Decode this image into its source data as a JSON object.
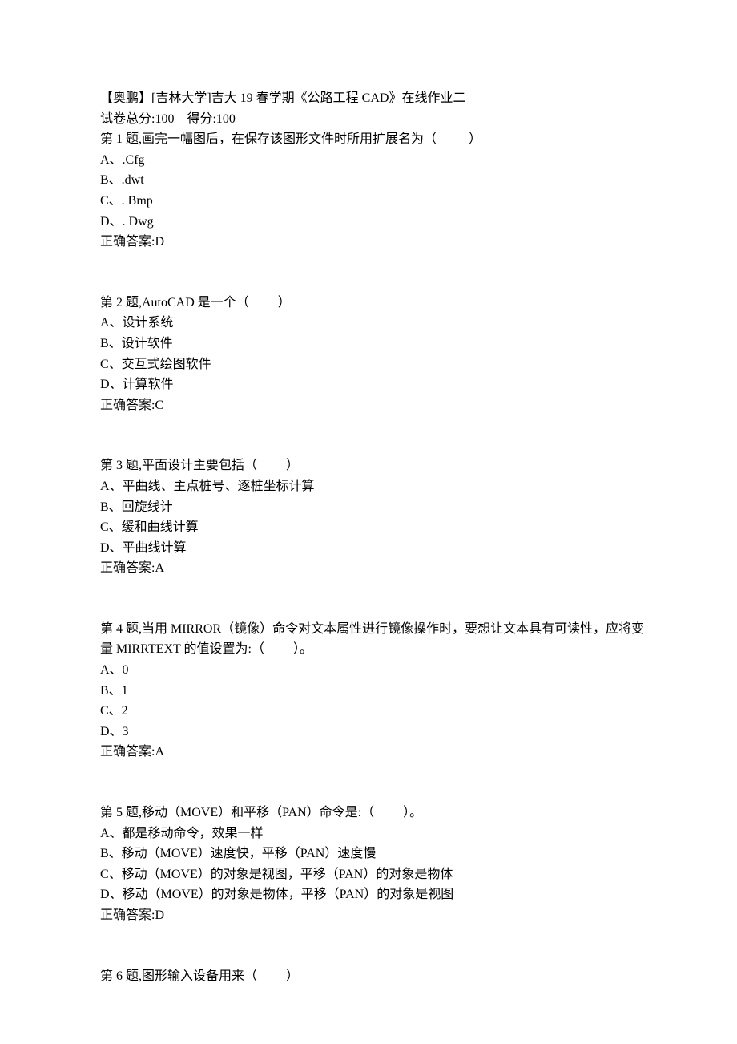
{
  "header": {
    "title": "【奥鹏】[吉林大学]吉大 19 春学期《公路工程 CAD》在线作业二",
    "scoreLine": "试卷总分:100    得分:100"
  },
  "questions": [
    {
      "stem": "第 1 题,画完一幅图后，在保存该图形文件时所用扩展名为（          ）",
      "options": [
        "A、.Cfg",
        "B、.dwt",
        "C、. Bmp",
        "D、. Dwg"
      ],
      "answer": "正确答案:D"
    },
    {
      "stem": "第 2 题,AutoCAD 是一个（         ）",
      "options": [
        "A、设计系统",
        "B、设计软件",
        "C、交互式绘图软件",
        "D、计算软件"
      ],
      "answer": "正确答案:C"
    },
    {
      "stem": "第 3 题,平面设计主要包括（         ）",
      "options": [
        "A、平曲线、主点桩号、逐桩坐标计算",
        "B、回旋线计",
        "C、缓和曲线计算",
        "D、平曲线计算"
      ],
      "answer": "正确答案:A"
    },
    {
      "stem": "第 4 题,当用 MIRROR（镜像）命令对文本属性进行镜像操作时，要想让文本具有可读性，应将变量 MIRRTEXT 的值设置为:（         ）。",
      "options": [
        "A、0",
        "B、1",
        "C、2",
        "D、3"
      ],
      "answer": "正确答案:A"
    },
    {
      "stem": "第 5 题,移动（MOVE）和平移（PAN）命令是:（         ）。",
      "options": [
        "A、都是移动命令，效果一样",
        "B、移动（MOVE）速度快，平移（PAN）速度慢",
        "C、移动（MOVE）的对象是视图，平移（PAN）的对象是物体",
        "D、移动（MOVE）的对象是物体，平移（PAN）的对象是视图"
      ],
      "answer": "正确答案:D"
    },
    {
      "stem": "第 6 题,图形输入设备用来（         ）",
      "options": [],
      "answer": ""
    }
  ]
}
